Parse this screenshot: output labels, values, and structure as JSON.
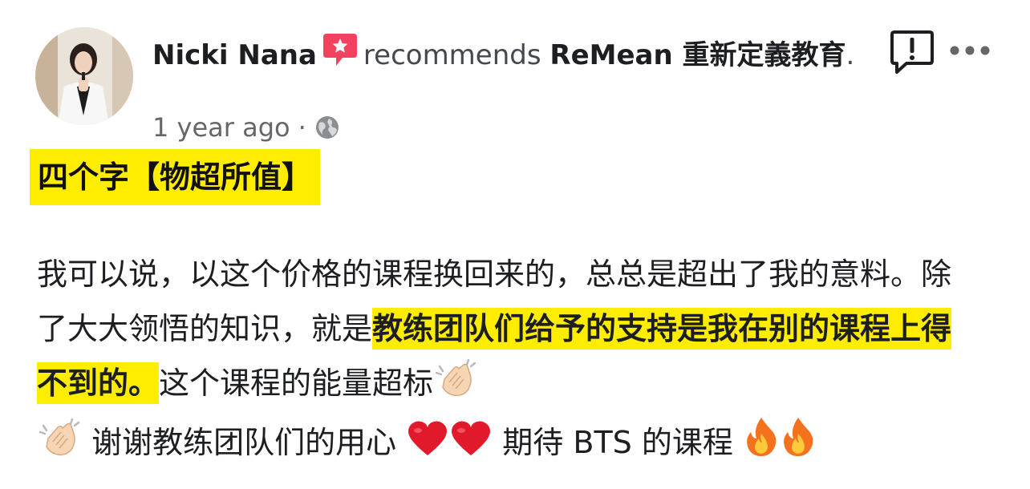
{
  "post": {
    "author": "Nicki Nana",
    "verb": "recommends",
    "page": "ReMean 重新定義教育",
    "period": ".",
    "timestamp": "1 year ago",
    "separator": "·",
    "privacy_icon": "globe-icon",
    "headline": "四个字【物超所值】",
    "body": {
      "part1": "我可以说，以这个价格的课程换回来的，总总是超出了我的意料。除了大大领悟的知识，就是",
      "highlight": "教练团队们给予的支持是我在别的课程上得不到的。",
      "part2": "这个课程的能量超标",
      "part3": "谢谢教练团队们的用心",
      "part4": "期待 BTS 的课程"
    }
  },
  "icons": {
    "recommend": "recommend-badge-icon",
    "report": "report-icon",
    "more": "more-options-icon",
    "clap": "clapping-hands-emoji",
    "heart": "red-heart-emoji",
    "fire": "fire-emoji"
  },
  "colors": {
    "highlight": "#ffed00",
    "recommend_badge": "#f3425f",
    "heart": "#e0192b",
    "secondary_text": "#65676b"
  }
}
